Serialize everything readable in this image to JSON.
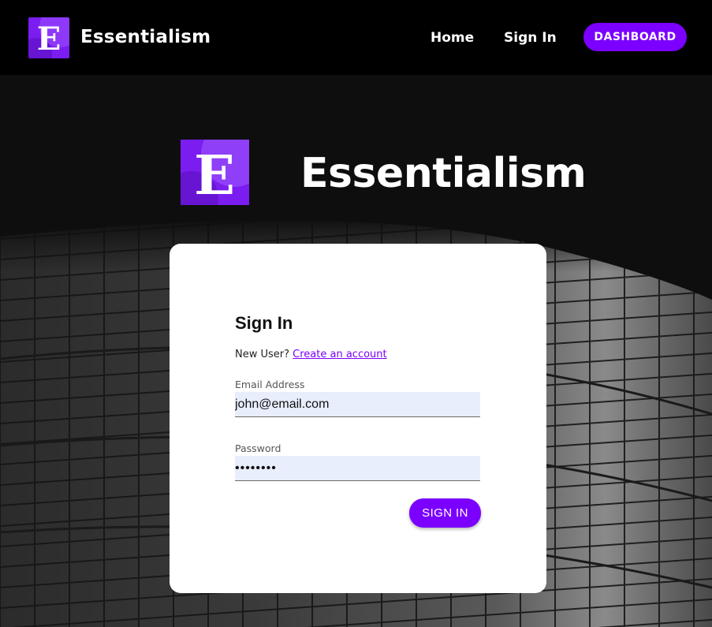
{
  "navbar": {
    "brand": "Essentialism",
    "logo_letter": "E",
    "links": {
      "home": "Home",
      "signin": "Sign In"
    },
    "dashboard_label": "DASHBOARD"
  },
  "hero": {
    "brand": "Essentialism",
    "logo_letter": "E"
  },
  "signin_card": {
    "title": "Sign In",
    "new_user_prefix": "New User?",
    "create_account_link": "Create an account",
    "email_label": "Email Address",
    "email_value": "john@email.com",
    "password_label": "Password",
    "password_value": "••••••••",
    "submit_label": "SIGN IN"
  },
  "colors": {
    "accent": "#7b00ff",
    "nav_bg": "#000000",
    "page_bg": "#0e0e0e",
    "input_bg": "#e8eefc"
  },
  "icons": {
    "logo": "essentialism-logo-icon"
  }
}
